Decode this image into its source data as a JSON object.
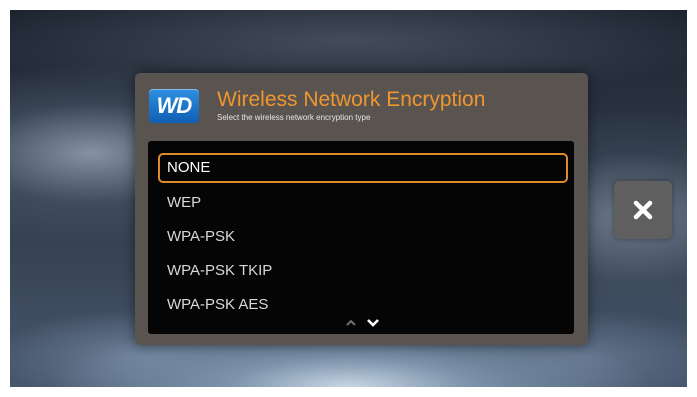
{
  "dialog": {
    "logo_text": "WD",
    "title": "Wireless Network Encryption",
    "subtitle": "Select the wireless network encryption type",
    "options": [
      {
        "label": "NONE",
        "selected": true
      },
      {
        "label": "WEP",
        "selected": false
      },
      {
        "label": "WPA-PSK",
        "selected": false
      },
      {
        "label": "WPA-PSK TKIP",
        "selected": false
      },
      {
        "label": "WPA-PSK AES",
        "selected": false
      }
    ],
    "scroll_up_icon": "chevron-up-icon",
    "scroll_down_icon": "chevron-down-icon"
  },
  "close_button": {
    "icon": "close-icon"
  },
  "colors": {
    "accent": "#e08a2c",
    "title": "#f0962f",
    "dialog_bg": "#5a5450",
    "list_bg": "#050505",
    "logo_blue": "#1a6fc9"
  }
}
